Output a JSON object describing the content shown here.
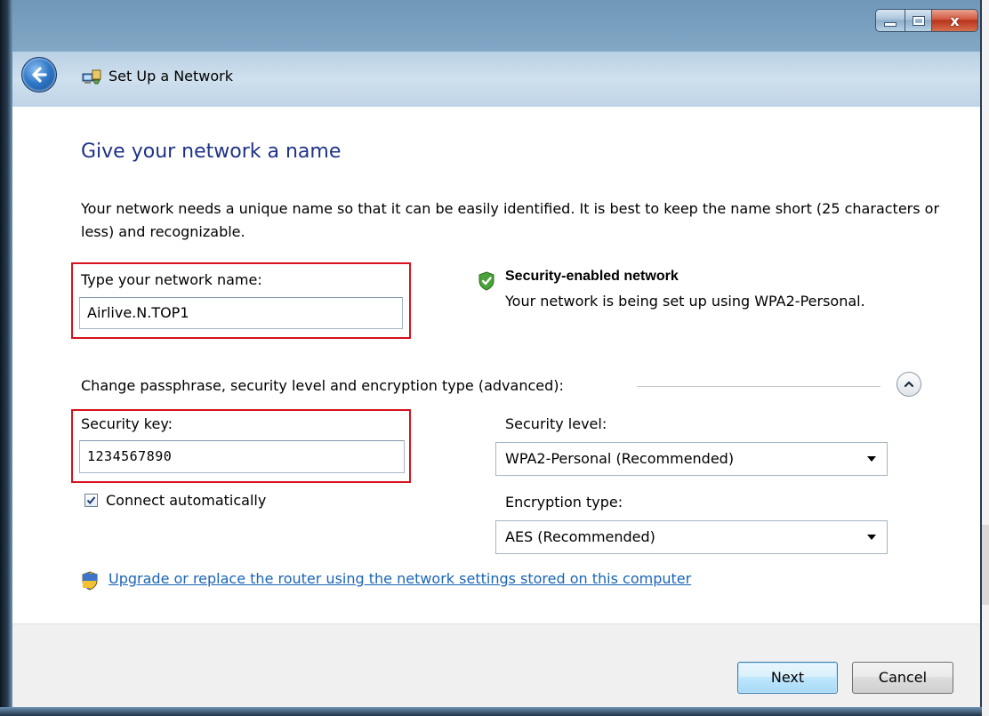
{
  "window": {
    "title": "Set Up a Network",
    "minimize_glyph": "minimize-icon",
    "maximize_glyph": "maximize-icon",
    "close_glyph": "x",
    "back_icon": "back-arrow-icon",
    "app_icon": "network-setup-icon"
  },
  "page": {
    "heading": "Give your network a name",
    "description": "Your network needs a unique name so that it can be easily identified. It is best to keep the name short (25 characters or less) and recognizable."
  },
  "network_name": {
    "label": "Type your network name:",
    "value": "Airlive.N.TOP1"
  },
  "security_info": {
    "icon": "shield-check-icon",
    "title": "Security-enabled network",
    "description": "Your network is being set up using WPA2-Personal."
  },
  "advanced": {
    "label": "Change passphrase, security level and encryption type (advanced):",
    "toggle_icon": "chevron-up-icon"
  },
  "security_key": {
    "label": "Security key:",
    "value": "1234567890"
  },
  "connect_auto": {
    "label": "Connect automatically",
    "checked": true
  },
  "security_level": {
    "label": "Security level:",
    "selected": "WPA2-Personal (Recommended)"
  },
  "encryption_type": {
    "label": "Encryption type:",
    "selected": "AES (Recommended)"
  },
  "router_link": {
    "icon": "uac-shield-icon",
    "text": "Upgrade or replace the router using the network settings stored on this computer"
  },
  "footer": {
    "next_label": "Next",
    "cancel_label": "Cancel"
  },
  "colors": {
    "heading": "#1e3287",
    "link": "#1a64b6",
    "highlight_box": "#d7111d"
  }
}
